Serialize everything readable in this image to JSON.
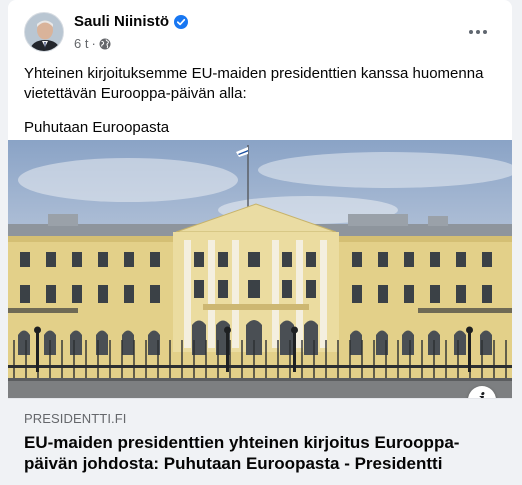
{
  "post": {
    "author": "Sauli Niinistö",
    "time": "6 t",
    "separator": "·",
    "text_line1": "Yhteinen kirjoituksemme EU-maiden presidenttien kanssa huomenna vietettävän Eurooppa-päivän alla:",
    "text_line2": "Puhutaan Euroopasta"
  },
  "link": {
    "domain": "PRESIDENTTI.FI",
    "title": "EU-maiden presidenttien yhteinen kirjoitus Eurooppa-päivän johdosta: Puhutaan Euroopasta - Presidentti"
  },
  "icons": {
    "verified": "verified-badge-icon",
    "audience": "globe-icon",
    "more": "more-options-icon",
    "info": "info-icon"
  },
  "colors": {
    "verified_blue": "#1877f2",
    "secondary_text": "#65676b",
    "building_yellow": "#e3d089"
  }
}
